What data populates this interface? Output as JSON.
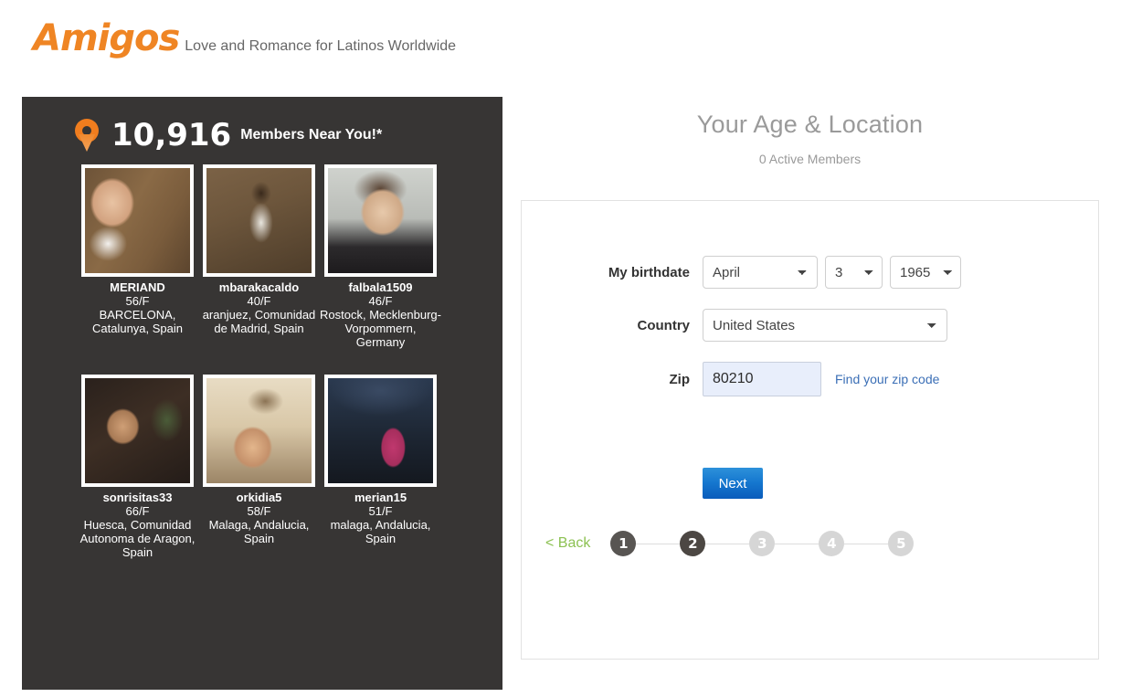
{
  "header": {
    "logo_text": "Amigos",
    "tagline": "Love and Romance for Latinos Worldwide",
    "logo_color": "#ef8524"
  },
  "promo": {
    "pin_icon": "map-pin-icon",
    "count": "10,916",
    "count_label": "Members Near You!*",
    "members": [
      {
        "name": "MERIAND",
        "age": "56/F",
        "location": "BARCELONA, Catalunya, Spain"
      },
      {
        "name": "mbarakacaldo",
        "age": "40/F",
        "location": "aranjuez, Comunidad de Madrid, Spain"
      },
      {
        "name": "falbala1509",
        "age": "46/F",
        "location": "Rostock, Mecklenburg-Vorpommern, Germany"
      },
      {
        "name": "sonrisitas33",
        "age": "66/F",
        "location": "Huesca, Comunidad Autonoma de Aragon, Spain"
      },
      {
        "name": "orkidia5",
        "age": "58/F",
        "location": "Malaga, Andalucia, Spain"
      },
      {
        "name": "merian15",
        "age": "51/F",
        "location": "malaga, Andalucia, Spain"
      }
    ]
  },
  "signup": {
    "title": "Your Age & Location",
    "subtitle": "0 Active Members",
    "fields": {
      "birthdate_label": "My birthdate",
      "birth_month": "April",
      "birth_day": "3",
      "birth_year": "1965",
      "country_label": "Country",
      "country": "United States",
      "zip_label": "Zip",
      "zip_value": "80210",
      "zip_placeholder": "Zip",
      "zip_link": "Find your zip code"
    },
    "next_label": "Next",
    "back_label": "< Back",
    "steps": [
      {
        "number": "1",
        "state": "done"
      },
      {
        "number": "2",
        "state": "active"
      },
      {
        "number": "3",
        "state": "todo"
      },
      {
        "number": "4",
        "state": "todo"
      },
      {
        "number": "5",
        "state": "todo"
      }
    ],
    "accent_blue": "#1577cf",
    "back_green": "#8cc152",
    "link_blue": "#3b6fb6"
  }
}
